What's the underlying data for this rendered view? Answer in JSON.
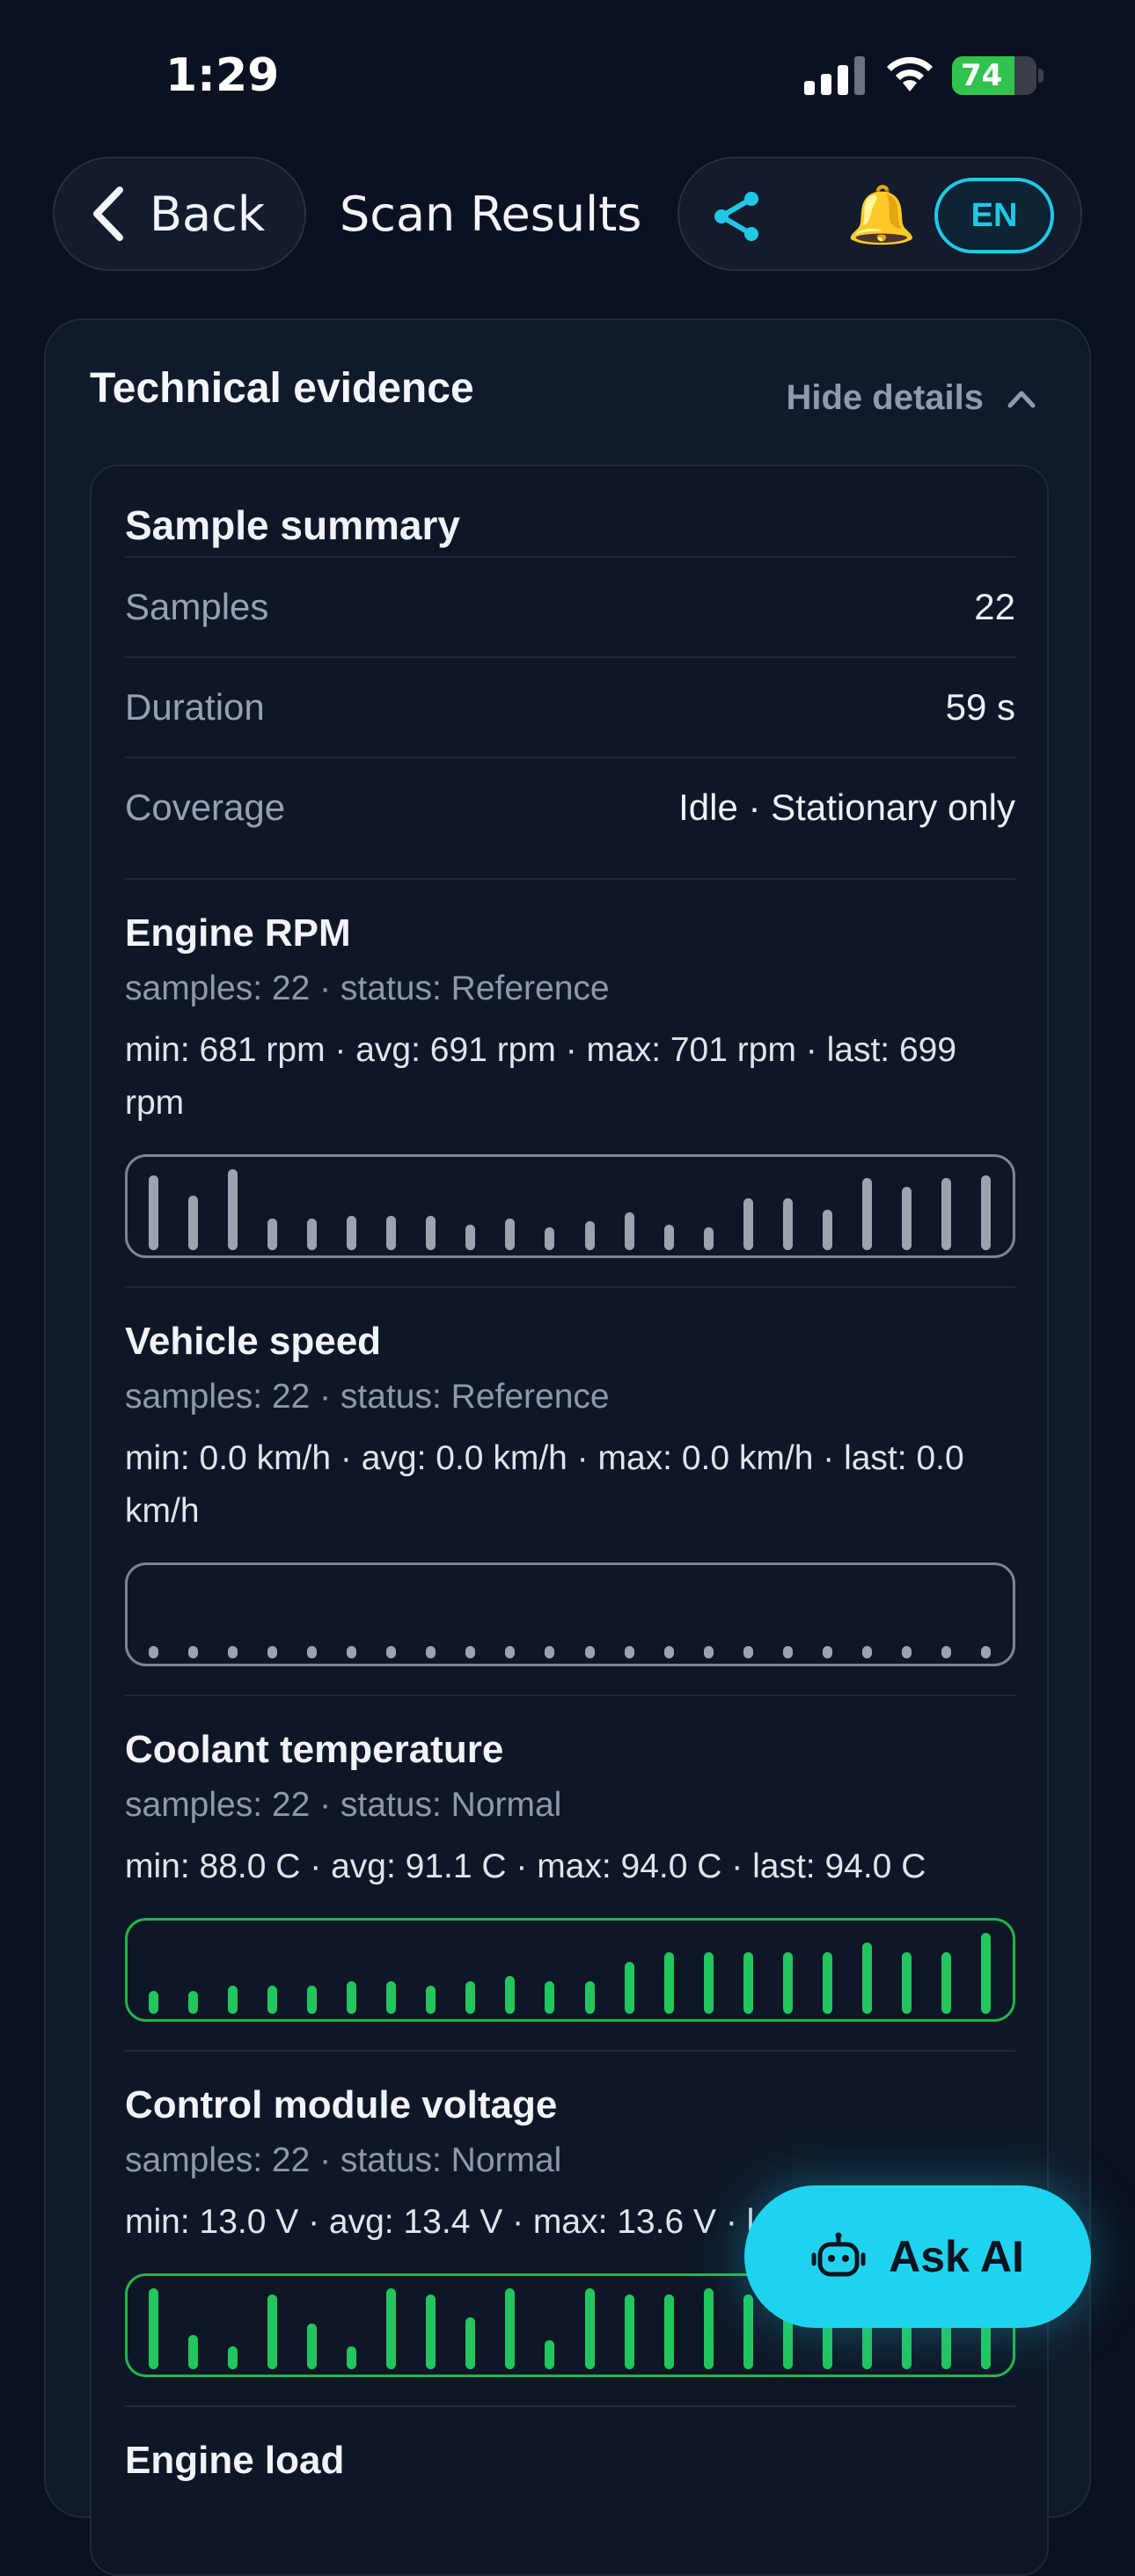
{
  "status_bar": {
    "time": "1:29",
    "battery": "74",
    "battery_level": 0.74
  },
  "header": {
    "back_label": "Back",
    "title": "Scan Results",
    "lang": "EN"
  },
  "card": {
    "title": "Technical evidence",
    "toggle_label": "Hide details"
  },
  "summary": {
    "title": "Sample summary",
    "rows": [
      {
        "key": "Samples",
        "value": "22"
      },
      {
        "key": "Duration",
        "value": "59 s"
      },
      {
        "key": "Coverage",
        "value": "Idle · Stationary only"
      }
    ]
  },
  "metrics": [
    {
      "name": "Engine RPM",
      "sub": "samples: 22 · status: Reference",
      "stats": "min: 681 rpm · avg: 691 rpm · max: 701 rpm · last: 699 rpm",
      "tone": "neutral",
      "values": [
        699,
        692,
        701,
        684,
        684,
        685,
        685,
        685,
        682,
        684,
        681,
        683,
        686,
        682,
        681,
        691,
        691,
        687,
        698,
        695,
        698,
        699
      ]
    },
    {
      "name": "Vehicle speed",
      "sub": "samples: 22 · status: Reference",
      "stats": "min: 0.0 km/h · avg: 0.0 km/h · max: 0.0 km/h · last: 0.0 km/h",
      "tone": "neutral",
      "values": [
        0,
        0,
        0,
        0,
        0,
        0,
        0,
        0,
        0,
        0,
        0,
        0,
        0,
        0,
        0,
        0,
        0,
        0,
        0,
        0,
        0,
        0
      ]
    },
    {
      "name": "Coolant temperature",
      "sub": "samples: 22 · status: Normal",
      "stats": "min: 88.0 C · avg: 91.1 C · max: 94.0 C · last: 94.0 C",
      "tone": "normal",
      "values": [
        88,
        88,
        88.5,
        88.5,
        88.5,
        89,
        89,
        88.5,
        89,
        89.5,
        89,
        89,
        91,
        92,
        92,
        92,
        92,
        92,
        93,
        92,
        92,
        94
      ]
    },
    {
      "name": "Control module voltage",
      "sub": "samples: 22 · status: Normal",
      "stats": "min: 13.0 V · avg: 13.4 V · max: 13.6 V · last: 13.6 V",
      "tone": "normal",
      "values": [
        13.6,
        13.2,
        13.1,
        13.55,
        13.3,
        13.1,
        13.6,
        13.55,
        13.35,
        13.6,
        13.15,
        13.6,
        13.55,
        13.55,
        13.6,
        13.55,
        13.55,
        13.55,
        13.55,
        13.55,
        13.55,
        13.55
      ]
    },
    {
      "name": "Engine load",
      "sub": "",
      "stats": "",
      "tone": "neutral",
      "values": []
    }
  ],
  "ask_ai": {
    "label": "Ask AI"
  },
  "colors": {
    "accent": "#22c7e6",
    "normal": "#22c55e",
    "reference": "#9ba3b1"
  }
}
